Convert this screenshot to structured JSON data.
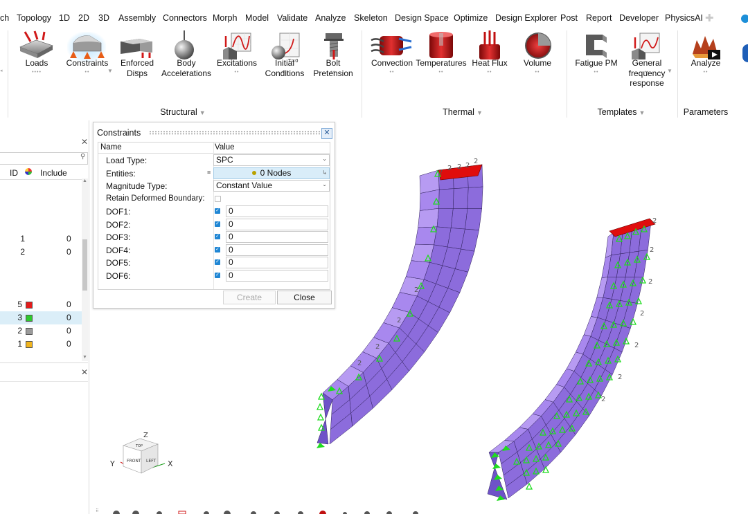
{
  "menu": {
    "items": [
      "ch",
      "Topology",
      "1D",
      "2D",
      "3D",
      "Assembly",
      "Connectors",
      "Morph",
      "Model",
      "Validate",
      "Analyze",
      "Skeleton",
      "Design Space",
      "Optimize",
      "Design Explorer",
      "Post",
      "Report",
      "Developer",
      "PhysicsAI"
    ],
    "active": "Analyze"
  },
  "ribbon": {
    "tools": {
      "loads": "Loads",
      "constraints": "Constraints",
      "enforced_disps": "Enforced\nDisps",
      "body_accelerations": "Body\nAccelerations",
      "excitations": "Excitations",
      "initial_conditions": "Initial\nConditions",
      "bolt_pretension": "Bolt\nPretension",
      "convection": "Convection",
      "temperatures": "Temperatures",
      "heat_flux": "Heat Flux",
      "volume": "Volume",
      "fatigue_pm": "Fatigue PM",
      "general_frequency_response": "General\nfrequency\nresponse",
      "analyze": "Analyze"
    },
    "icon_labels": {
      "initial_conditions_icon": "T=0"
    },
    "groups": {
      "structural": "Structural",
      "thermal": "Thermal",
      "templates": "Templates",
      "parameters": "Parameters"
    }
  },
  "left_panel": {
    "columns": {
      "id": "ID",
      "include": "Include"
    },
    "rows_top": [
      {
        "id": "1",
        "include": "0"
      },
      {
        "id": "2",
        "include": "0"
      }
    ],
    "rows_bottom": [
      {
        "id": "5",
        "color": "#e31b1b",
        "include": "0"
      },
      {
        "id": "3",
        "color": "#2ec82e",
        "include": "0",
        "selected": true
      },
      {
        "id": "2",
        "color": "#9a9a9a",
        "include": "0"
      },
      {
        "id": "1",
        "color": "#f0b41e",
        "include": "0"
      }
    ]
  },
  "dialog": {
    "title": "Constraints",
    "columns": {
      "name": "Name",
      "value": "Value"
    },
    "load_type": {
      "label": "Load Type:",
      "value": "SPC"
    },
    "entities": {
      "label": "Entities:",
      "value": "0 Nodes"
    },
    "magnitude_type": {
      "label": "Magnitude Type:",
      "value": "Constant Value"
    },
    "retain": {
      "label": "Retain Deformed Boundary:",
      "checked": false
    },
    "dofs": [
      {
        "label": "DOF1:",
        "checked": true,
        "value": "0"
      },
      {
        "label": "DOF2:",
        "checked": true,
        "value": "0"
      },
      {
        "label": "DOF3:",
        "checked": true,
        "value": "0"
      },
      {
        "label": "DOF4:",
        "checked": true,
        "value": "0"
      },
      {
        "label": "DOF5:",
        "checked": true,
        "value": "0"
      },
      {
        "label": "DOF6:",
        "checked": true,
        "value": "0"
      }
    ],
    "buttons": {
      "create": "Create",
      "close": "Close"
    }
  },
  "viewport": {
    "node_marker": "2",
    "view_cube": {
      "front": "FRONT",
      "left": "LEFT",
      "top": "TOP",
      "axis_x": "X",
      "axis_y": "Y",
      "axis_z": "Z"
    }
  },
  "colors": {
    "accent": "#2b74c7",
    "mesh_fill": "#8c6cdc",
    "mesh_light": "#b79bf2",
    "mesh_edge": "#2d1f58",
    "constraint_green": "#1fdc1f",
    "fixed_face_red": "#e00d0d"
  }
}
